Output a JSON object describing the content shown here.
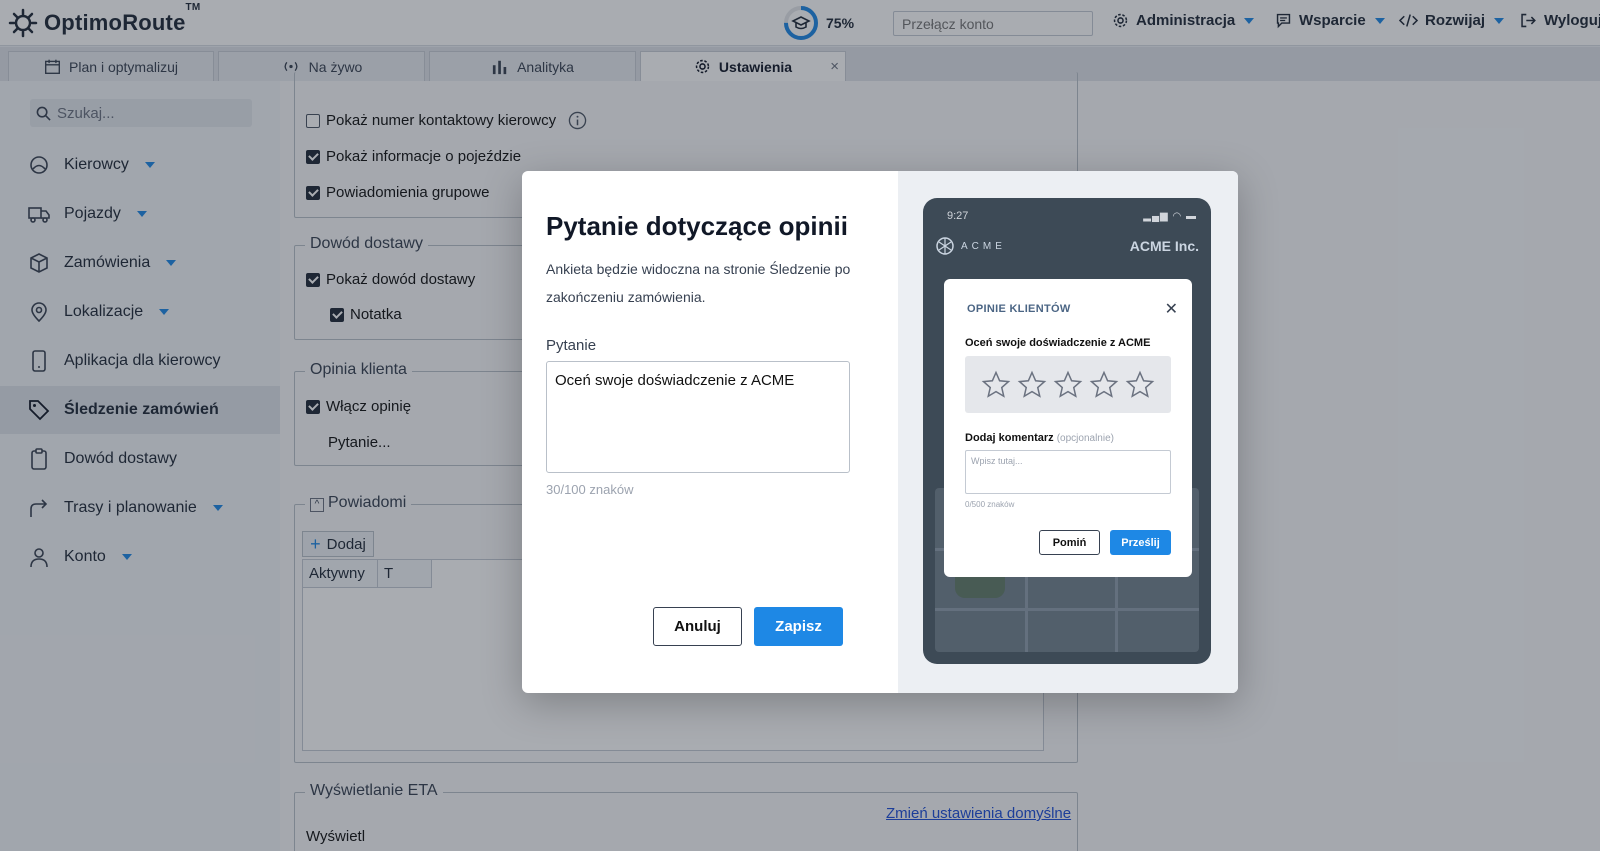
{
  "app": {
    "logo_text": "OptimoRoute",
    "logo_tm": "TM",
    "progress_label": "75%",
    "progress_fraction": 0.75,
    "switch_placeholder": "Przełącz konto",
    "nav": {
      "admin": "Administracja",
      "support": "Wsparcie",
      "develop": "Rozwijaj",
      "logout": "Wyloguj"
    }
  },
  "tabs": [
    {
      "label": "Plan i optymalizuj",
      "icon": "calendar-icon"
    },
    {
      "label": "Na żywo",
      "icon": "broadcast-icon"
    },
    {
      "label": "Analityka",
      "icon": "bar-chart-icon"
    },
    {
      "label": "Ustawienia",
      "icon": "gear-icon",
      "close": "×"
    }
  ],
  "sidebar": {
    "search_placeholder": "Szukaj...",
    "items": [
      {
        "label": "Kierowcy",
        "icon": "drivers-icon"
      },
      {
        "label": "Pojazdy",
        "icon": "truck-icon"
      },
      {
        "label": "Zamówienia",
        "icon": "box-icon"
      },
      {
        "label": "Lokalizacje",
        "icon": "location-pin-icon"
      },
      {
        "label": "Aplikacja dla kierowcy",
        "icon": "phone-icon"
      },
      {
        "label": "Śledzenie zamówień",
        "icon": "tag-icon"
      },
      {
        "label": "Dowód dostawy",
        "icon": "clipboard-icon"
      },
      {
        "label": "Trasy i planowanie",
        "icon": "route-arrow-icon"
      },
      {
        "label": "Konto",
        "icon": "user-icon"
      }
    ]
  },
  "settings": {
    "top_checks": [
      {
        "label": "Pokaż numer kontaktowy kierowcy",
        "checked": false
      },
      {
        "label": "Pokaż informacje o pojeździe",
        "checked": true
      },
      {
        "label": "Powiadomienia grupowe",
        "checked": true
      }
    ],
    "pod": {
      "legend": "Dowód dostawy",
      "show_pod": "Pokaż dowód dostawy",
      "note": "Notatka"
    },
    "feedback": {
      "legend": "Opinia klienta",
      "enable": "Włącz opinię",
      "question": "Pytanie..."
    },
    "notifications": {
      "legend": "Powiadomi",
      "add": "Dodaj",
      "col_active": "Aktywny",
      "col_t": "T"
    },
    "eta": {
      "legend": "Wyświetlanie ETA",
      "change_defaults": "Zmień ustawienia domyślne",
      "display": "Wyświetl"
    }
  },
  "modal": {
    "title": "Pytanie dotyczące opinii",
    "description": "Ankieta będzie widoczna na stronie Śledzenie po zakończeniu zamówienia.",
    "question_label": "Pytanie",
    "question_value": "Oceń swoje doświadczenie z ACME",
    "counter": "30/100 znaków",
    "cancel": "Anuluj",
    "save": "Zapisz"
  },
  "preview": {
    "time": "9:27",
    "brand": "ACME",
    "company": "ACME Inc.",
    "card_title": "OPINIE KLIENTÓW",
    "question": "Oceń swoje doświadczenie z ACME",
    "stars": 5,
    "comment_label": "Dodaj komentarz",
    "comment_optional": "(opcjonalnie)",
    "comment_placeholder": "Wpisz tutaj...",
    "comment_counter": "0/500 znaków",
    "skip": "Pomiń",
    "submit": "Prześlij"
  },
  "colors": {
    "accent": "#1e88e5",
    "overlay": "rgba(30,38,50,0.38)"
  }
}
